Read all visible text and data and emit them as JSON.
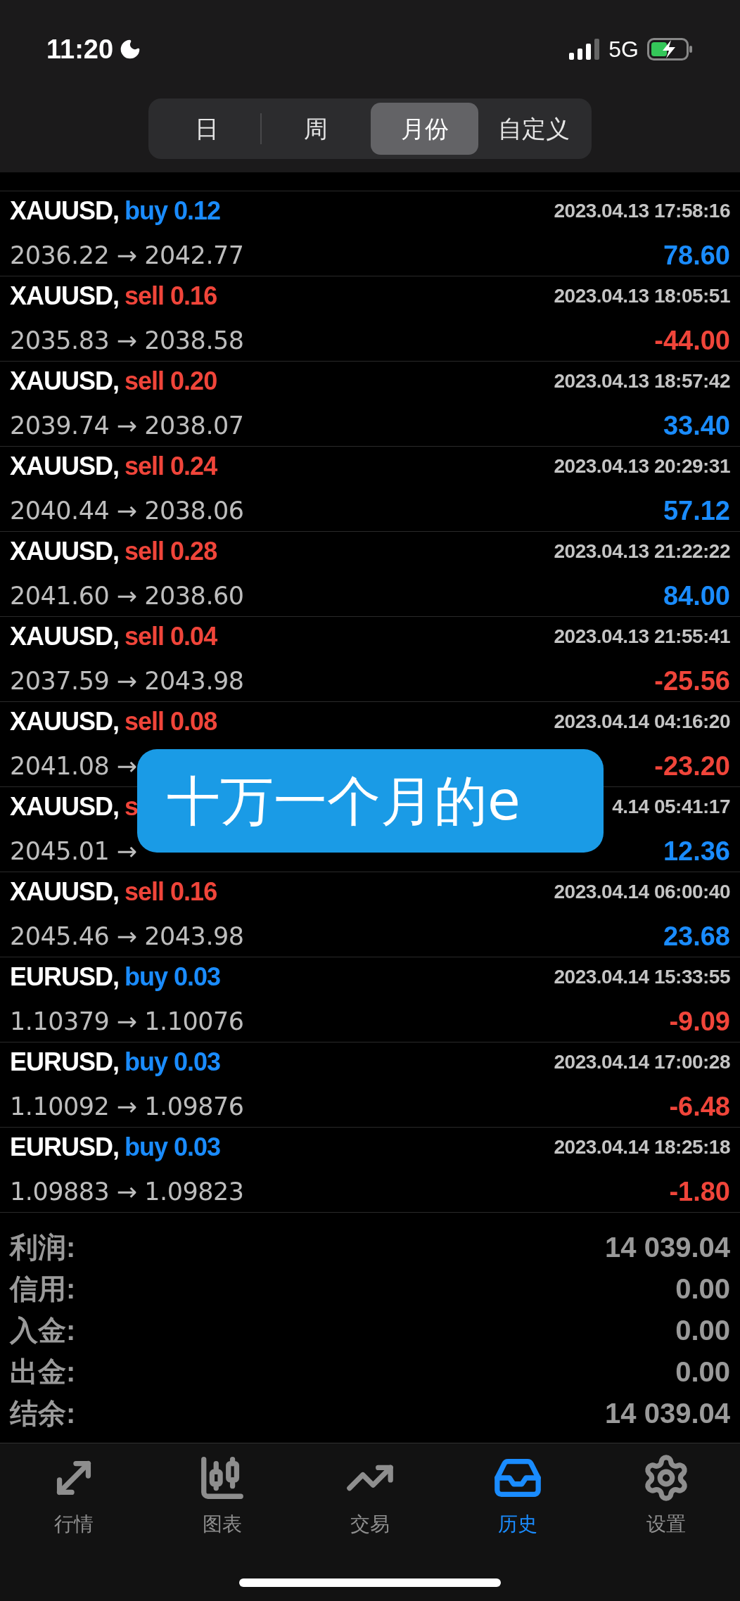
{
  "status_bar": {
    "time": "11:20",
    "network": "5G"
  },
  "period_tabs": [
    {
      "label": "日",
      "selected": false
    },
    {
      "label": "周",
      "selected": false
    },
    {
      "label": "月份",
      "selected": true
    },
    {
      "label": "自定义",
      "selected": false
    }
  ],
  "deals": [
    {
      "symbol": "XAUUSD,",
      "order": "buy 0.12",
      "kind": "buy",
      "time": "2023.04.13 17:58:16",
      "prices": "2036.22 → 2042.77",
      "profit": "78.60",
      "color": "#1a8cff"
    },
    {
      "symbol": "XAUUSD,",
      "order": "sell 0.16",
      "kind": "sell",
      "time": "2023.04.13 18:05:51",
      "prices": "2035.83 → 2038.58",
      "profit": "-44.00",
      "color": "#f0453a"
    },
    {
      "symbol": "XAUUSD,",
      "order": "sell 0.20",
      "kind": "sell",
      "time": "2023.04.13 18:57:42",
      "prices": "2039.74 → 2038.07",
      "profit": "33.40",
      "color": "#1a8cff"
    },
    {
      "symbol": "XAUUSD,",
      "order": "sell 0.24",
      "kind": "sell",
      "time": "2023.04.13 20:29:31",
      "prices": "2040.44 → 2038.06",
      "profit": "57.12",
      "color": "#1a8cff"
    },
    {
      "symbol": "XAUUSD,",
      "order": "sell 0.28",
      "kind": "sell",
      "time": "2023.04.13 21:22:22",
      "prices": "2041.60 → 2038.60",
      "profit": "84.00",
      "color": "#1a8cff"
    },
    {
      "symbol": "XAUUSD,",
      "order": "sell 0.04",
      "kind": "sell",
      "time": "2023.04.13 21:55:41",
      "prices": "2037.59 → 2043.98",
      "profit": "-25.56",
      "color": "#f0453a"
    },
    {
      "symbol": "XAUUSD,",
      "order": "sell 0.08",
      "kind": "sell",
      "time": "2023.04.14 04:16:20",
      "prices": "2041.08 →",
      "profit": "-23.20",
      "color": "#f0453a"
    },
    {
      "symbol": "XAUUSD,",
      "order": "s",
      "kind": "sell",
      "time": "4.14 05:41:17",
      "prices": "2045.01 →",
      "profit": "12.36",
      "color": "#1a8cff"
    },
    {
      "symbol": "XAUUSD,",
      "order": "sell 0.16",
      "kind": "sell",
      "time": "2023.04.14 06:00:40",
      "prices": "2045.46 → 2043.98",
      "profit": "23.68",
      "color": "#1a8cff"
    },
    {
      "symbol": "EURUSD,",
      "order": "buy 0.03",
      "kind": "buy",
      "time": "2023.04.14 15:33:55",
      "prices": "1.10379 → 1.10076",
      "profit": "-9.09",
      "color": "#f0453a"
    },
    {
      "symbol": "EURUSD,",
      "order": "buy 0.03",
      "kind": "buy",
      "time": "2023.04.14 17:00:28",
      "prices": "1.10092 → 1.09876",
      "profit": "-6.48",
      "color": "#f0453a"
    },
    {
      "symbol": "EURUSD,",
      "order": "buy 0.03",
      "kind": "buy",
      "time": "2023.04.14 18:25:18",
      "prices": "1.09883 → 1.09823",
      "profit": "-1.80",
      "color": "#f0453a"
    }
  ],
  "summary": [
    {
      "label": "利润:",
      "value": "14 039.04"
    },
    {
      "label": "信用:",
      "value": "0.00"
    },
    {
      "label": "入金:",
      "value": "0.00"
    },
    {
      "label": "出金:",
      "value": "0.00"
    },
    {
      "label": "结余:",
      "value": "14 039.04"
    }
  ],
  "caption": "十万一个月的e",
  "bottom_tabs": [
    {
      "label": "行情",
      "kind": "quotes",
      "selected": false
    },
    {
      "label": "图表",
      "kind": "chart",
      "selected": false
    },
    {
      "label": "交易",
      "kind": "trade",
      "selected": false
    },
    {
      "label": "历史",
      "kind": "history",
      "selected": true
    },
    {
      "label": "设置",
      "kind": "settings",
      "selected": false
    }
  ]
}
